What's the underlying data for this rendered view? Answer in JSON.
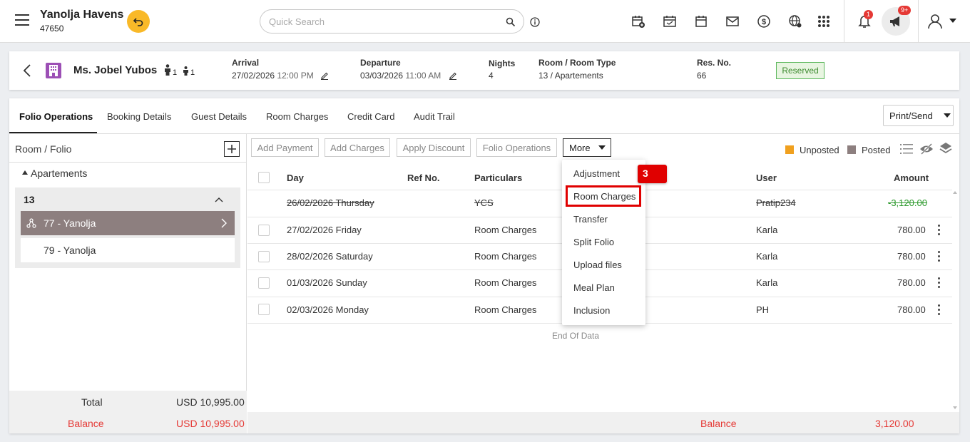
{
  "header": {
    "hotel_name": "Yanolja Havens",
    "hotel_id": "47650",
    "search_placeholder": "Quick Search",
    "notification_count": "1",
    "announcement_count": "9+"
  },
  "reservation": {
    "guest_name": "Ms. Jobel Yubos",
    "adults": "1",
    "children": "1",
    "arrival_label": "Arrival",
    "arrival_date": "27/02/2026",
    "arrival_time": "12:00 PM",
    "departure_label": "Departure",
    "departure_date": "03/03/2026",
    "departure_time": "11:00 AM",
    "nights_label": "Nights",
    "nights": "4",
    "room_label": "Room / Room Type",
    "room": "13 / Apartements",
    "resno_label": "Res. No.",
    "resno": "66",
    "status": "Reserved"
  },
  "tabs": [
    "Folio Operations",
    "Booking Details",
    "Guest Details",
    "Room Charges",
    "Credit Card",
    "Audit Trail"
  ],
  "print_send": "Print/Send",
  "left_panel": {
    "title": "Room / Folio",
    "group": "Apartements",
    "room": "13",
    "folios": [
      "77 - Yanolja",
      "79 - Yanolja"
    ],
    "total_label": "Total",
    "total_value": "USD 10,995.00",
    "balance_label": "Balance",
    "balance_value": "USD 10,995.00"
  },
  "toolbar": {
    "add_payment": "Add Payment",
    "add_charges": "Add Charges",
    "apply_discount": "Apply Discount",
    "folio_operations": "Folio Operations",
    "more": "More",
    "unposted": "Unposted",
    "posted": "Posted"
  },
  "colors": {
    "unposted": "#f0a01e",
    "posted": "#8d7f7f",
    "selected_folio": "#8d7f7f",
    "balance": "#e53935",
    "highlight": "#e00000"
  },
  "table": {
    "headers": {
      "day": "Day",
      "ref": "Ref No.",
      "particulars": "Particulars",
      "user": "User",
      "amount": "Amount"
    },
    "rows": [
      {
        "day": "26/02/2026 Thursday",
        "particulars": "YCS",
        "user": "Pratip234",
        "amount": "-3,120.00"
      },
      {
        "day": "27/02/2026 Friday",
        "particulars": "Room Charges",
        "user": "Karla",
        "amount": "780.00"
      },
      {
        "day": "28/02/2026 Saturday",
        "particulars": "Room Charges",
        "user": "Karla",
        "amount": "780.00"
      },
      {
        "day": "01/03/2026 Sunday",
        "particulars": "Room Charges",
        "user": "Karla",
        "amount": "780.00"
      },
      {
        "day": "02/03/2026 Monday",
        "particulars": "Room Charges",
        "user": "PH",
        "amount": "780.00"
      }
    ],
    "end_text": "End Of Data",
    "balance_label": "Balance",
    "balance_value": "3,120.00"
  },
  "more_menu": {
    "items": [
      "Adjustment",
      "Room Charges",
      "Transfer",
      "Split Folio",
      "Upload files",
      "Meal Plan",
      "Inclusion"
    ],
    "step_marker": "3"
  }
}
